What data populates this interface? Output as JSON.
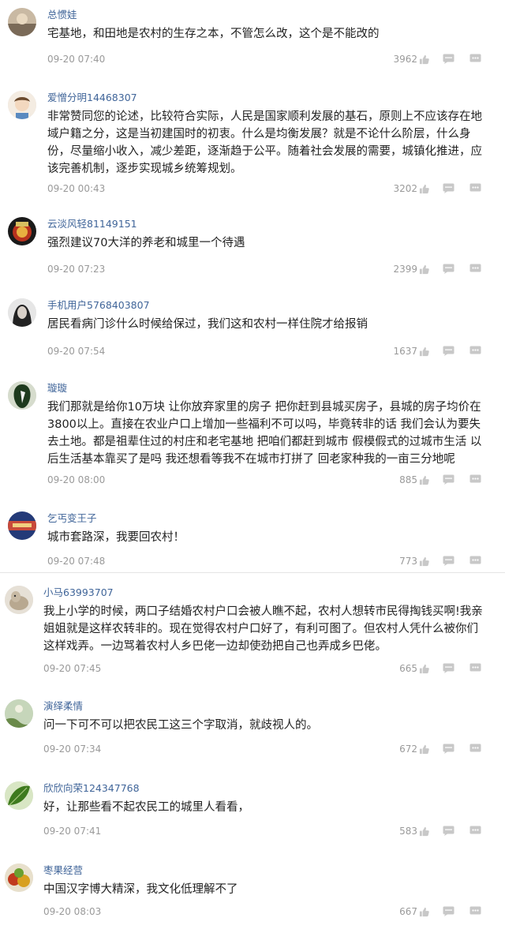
{
  "comments": [
    {
      "user": "总惯娃",
      "text": "宅基地，和田地是农村的生存之本，不管怎么改，这个是不能改的",
      "time": "09-20 07:40",
      "likes": "3962",
      "avatar_color": "#8a7a6a"
    },
    {
      "user": "爱憎分明14468307",
      "text": "非常赞同您的论述，比较符合实际，人民是国家顺利发展的基石，原则上不应该存在地域户籍之分，这是当初建国时的初衷。什么是均衡发展？就是不论什么阶层，什么身份，尽量缩小收入，减少差距，逐渐趋于公平。随着社会发展的需要，城镇化推进，应该完善机制，逐步实现城乡统筹规划。",
      "time": "09-20 00:43",
      "likes": "3202",
      "avatar_color": "#f2e6d6"
    },
    {
      "user": "云淡风轻81149151",
      "text": "强烈建议70大洋的养老和城里一个待遇",
      "time": "09-20 07:23",
      "likes": "2399",
      "avatar_color": "#5a2a10"
    },
    {
      "user": "手机用户5768403807",
      "text": "居民看病门诊什么时候给保过，我们这和农村一样住院才给报销",
      "time": "09-20 07:54",
      "likes": "1637",
      "avatar_color": "#3a3a3a"
    },
    {
      "user": "璇璇",
      "text": "我们那就是给你10万块 让你放弃家里的房子 把你赶到县城买房子，县城的房子均价在3800以上。直接在农业户口上增加一些福利不可以吗，毕竟转非的话 我们会认为要失去土地。都是祖辈住过的村庄和老宅基地 把咱们都赶到城市 假模假式的过城市生活 以后生活基本靠买了是吗 我还想看等我不在城市打拼了 回老家种我的一亩三分地呢",
      "time": "09-20 08:00",
      "likes": "885",
      "avatar_color": "#2e4a2e"
    },
    {
      "user": "乞丐变王子",
      "text": "城市套路深，我要回农村！",
      "time": "09-20 07:48",
      "likes": "773",
      "avatar_color": "#2a3a6a"
    },
    {
      "user": "小马63993707",
      "text": "我上小学的时候，两口子结婚农村户口会被人瞧不起，农村人想转市民得掏钱买啊!我亲姐姐就是这样农转非的。现在觉得农村户口好了，有利可图了。但农村人凭什么被你们这样戏弄。一边骂着农村人乡巴佬一边却使劲把自己也弄成乡巴佬。",
      "time": "09-20 07:45",
      "likes": "665",
      "avatar_color": "#b8aa98"
    },
    {
      "user": "演绎柔情",
      "text": "问一下可不可以把农民工这三个字取消，就歧视人的。",
      "time": "09-20 07:34",
      "likes": "672",
      "avatar_color": "#8aa070"
    },
    {
      "user": "欣欣向荣124347768",
      "text": "好，让那些看不起农民工的城里人看看，",
      "time": "09-20 07:41",
      "likes": "583",
      "avatar_color": "#3c6a22"
    },
    {
      "user": "枣果经营",
      "text": "中国汉字博大精深，我文化低理解不了",
      "time": "09-20 08:03",
      "likes": "667",
      "avatar_color": "#c04a2a"
    }
  ],
  "icons": {
    "like": "thumbs-up-icon",
    "reply": "comment-icon",
    "more": "more-dots-icon"
  },
  "colors": {
    "username": "#406599",
    "text": "#222222",
    "meta": "#9a9a9a",
    "divider": "#e5e5e5"
  }
}
